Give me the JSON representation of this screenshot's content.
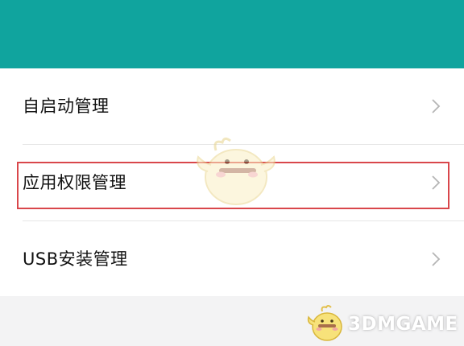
{
  "colors": {
    "header": "#10a49e",
    "list_background": "#ffffff",
    "page_background": "#f3f3f4",
    "highlight": "#d9474b",
    "chevron": "#b5b5b5"
  },
  "menu": {
    "items": [
      {
        "label": "自启动管理",
        "icon": "chevron-right-icon"
      },
      {
        "label": "应用权限管理",
        "icon": "chevron-right-icon"
      },
      {
        "label": "USB安装管理",
        "icon": "chevron-right-icon"
      }
    ]
  },
  "watermark": {
    "text": "3DMGAME"
  }
}
